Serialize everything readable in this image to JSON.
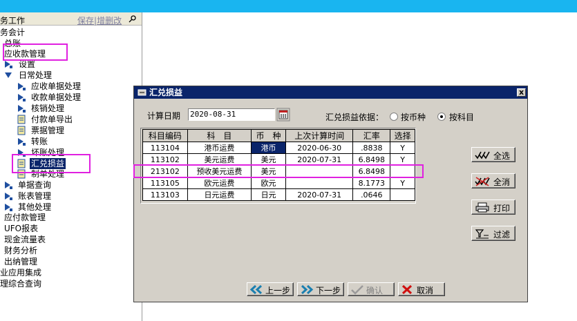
{
  "panel": {
    "title": "务工作",
    "save_label": "保存",
    "sep": "|",
    "edit_label": "增删改"
  },
  "tree": [
    {
      "label": "务会计"
    },
    {
      "label": "总账"
    },
    {
      "label": "应收款管理"
    },
    {
      "label": "设置"
    },
    {
      "label": "日常处理"
    },
    {
      "label": "应收单据处理"
    },
    {
      "label": "收款单据处理"
    },
    {
      "label": "核销处理"
    },
    {
      "label": "付款单导出"
    },
    {
      "label": "票据管理"
    },
    {
      "label": "转账"
    },
    {
      "label": "坏账处理"
    },
    {
      "label": "汇兑损益"
    },
    {
      "label": "制单处理"
    },
    {
      "label": "单据查询"
    },
    {
      "label": "账表管理"
    },
    {
      "label": "其他处理"
    },
    {
      "label": "应付款管理"
    },
    {
      "label": "UFO报表"
    },
    {
      "label": "现金流量表"
    },
    {
      "label": "财务分析"
    },
    {
      "label": "出纳管理"
    },
    {
      "label": "业应用集成"
    },
    {
      "label": "理综合查询"
    }
  ],
  "dialog": {
    "title": "汇兑损益",
    "close": "x",
    "date_label": "计算日期",
    "date_value": "2020-08-31",
    "basis_label": "汇兑损益依据：",
    "radio_currency": "按币种",
    "radio_subject": "按科目",
    "selected_basis": "按科目"
  },
  "table": {
    "headers": [
      "科目编码",
      "科　目",
      "币　种",
      "上次计算时间",
      "汇率",
      "选择"
    ],
    "rows": [
      [
        "113104",
        "港币运费",
        "港币",
        "2020-06-30",
        ".8838",
        "Y"
      ],
      [
        "113102",
        "美元运费",
        "美元",
        "2020-07-31",
        "6.8498",
        "Y"
      ],
      [
        "213102",
        "预收美元运费",
        "美元",
        "",
        "6.8498",
        ""
      ],
      [
        "113105",
        "欧元运费",
        "欧元",
        "",
        "8.1773",
        "Y"
      ],
      [
        "113103",
        "日元运费",
        "日元",
        "2020-07-31",
        ".0646",
        ""
      ]
    ]
  },
  "side_buttons": {
    "select_all": "全选",
    "clear_all": "全消",
    "print": "打印",
    "filter": "过滤"
  },
  "nav": {
    "prev": "上一步",
    "next": "下一步",
    "confirm": "确认",
    "cancel": "取消"
  },
  "colors": {
    "topbar": "#19b5f0",
    "titlebar": "#0a246a",
    "highlight": "#e020e0"
  }
}
